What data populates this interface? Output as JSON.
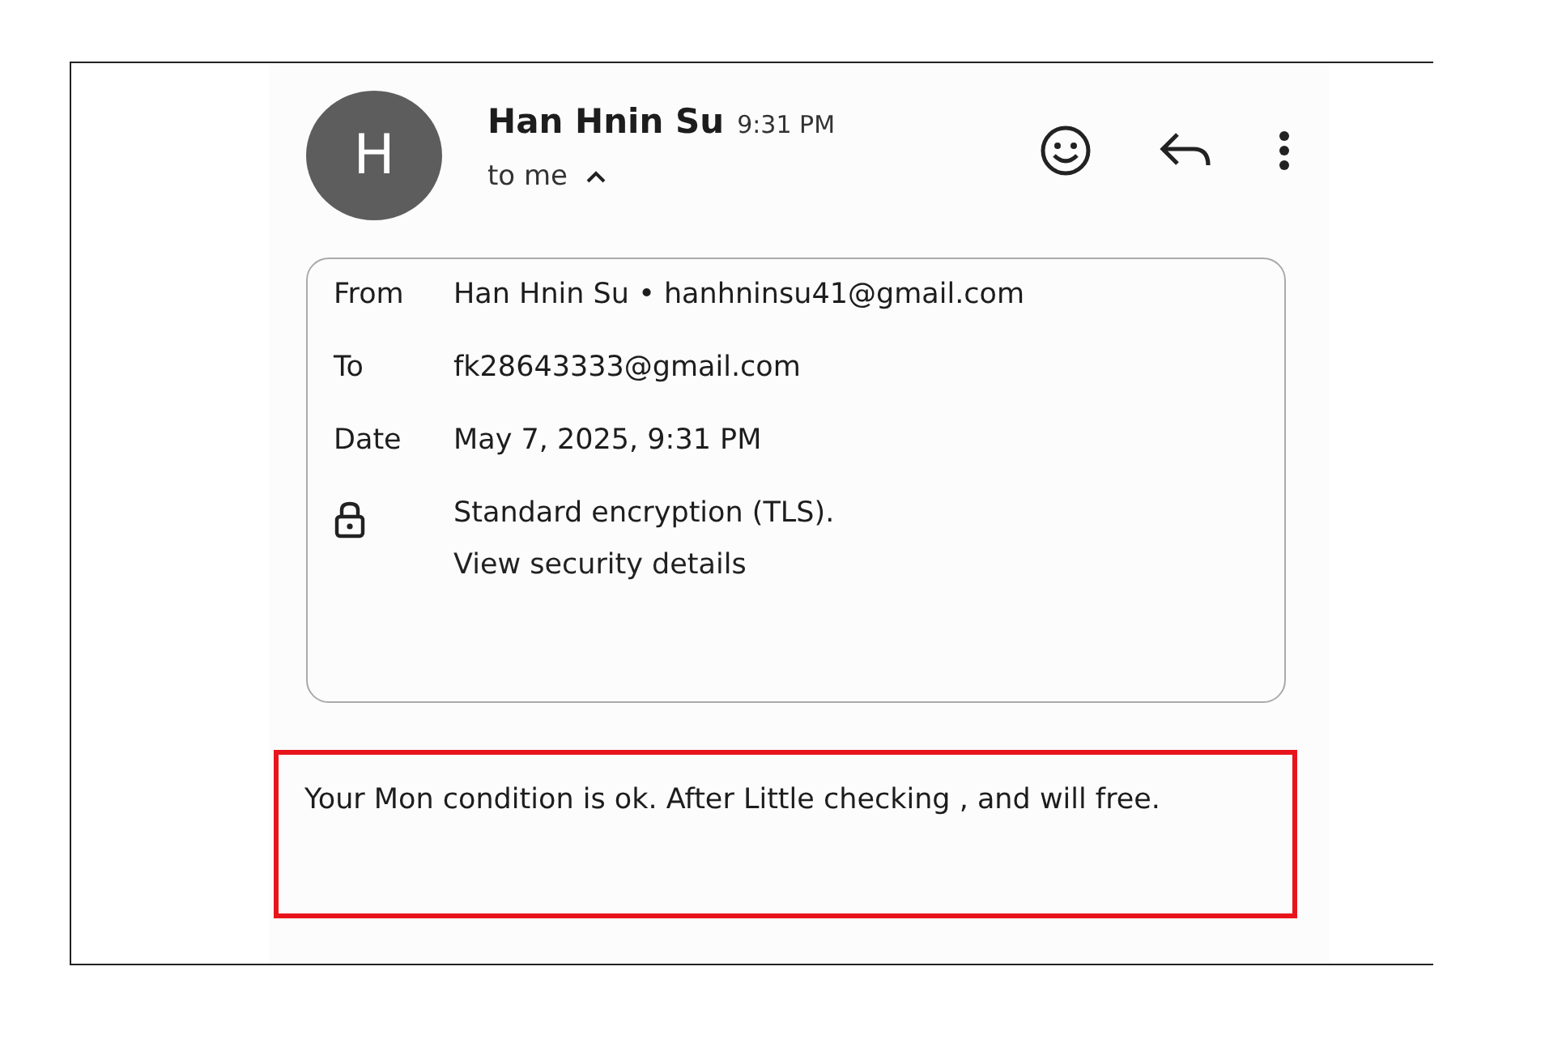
{
  "sender": {
    "avatar_letter": "H",
    "name": "Han Hnin Su",
    "time": "9:31 PM",
    "recipient_summary": "to me",
    "expanded": true
  },
  "details": [
    {
      "kind": "text",
      "label": "From",
      "value": "Han Hnin Su • hanhninsu41@gmail.com"
    },
    {
      "kind": "text",
      "label": "To",
      "value": "fk28643333@gmail.com"
    },
    {
      "kind": "text",
      "label": "Date",
      "value": "May 7, 2025, 9:31 PM"
    },
    {
      "kind": "lock",
      "value": "Standard encryption (TLS).",
      "link": "View security details"
    }
  ],
  "body": {
    "text": "Your Mon condition is ok. After Little checking , and will free.",
    "highlighted": true
  }
}
